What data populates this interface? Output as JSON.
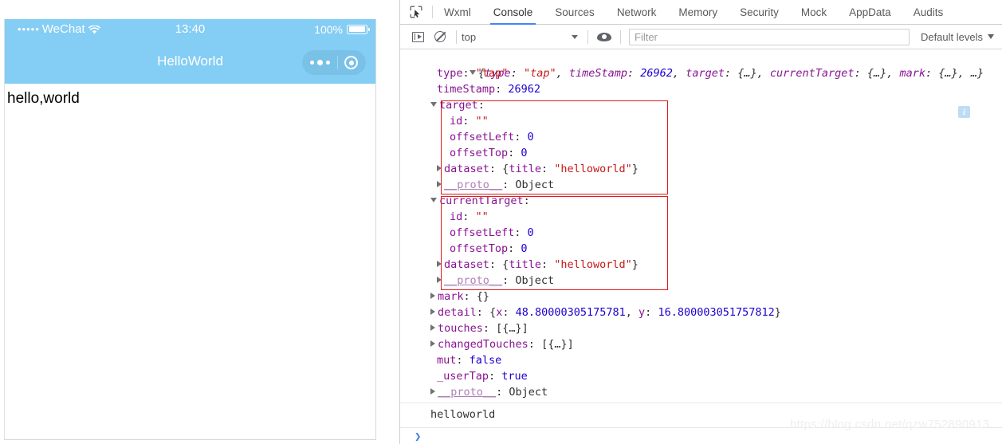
{
  "simulator": {
    "status_bar": {
      "signal_dots": "•••••",
      "carrier": "WeChat",
      "wifi_icon": "wifi-icon",
      "time": "13:40",
      "battery_percent": "100%",
      "battery_icon": "battery-icon"
    },
    "nav": {
      "title": "HelloWorld",
      "capsule": {
        "more_icon": "more-dots-icon",
        "target_icon": "target-circle-icon"
      }
    },
    "page_body_text": "hello,world",
    "theme_color": "#84cdf4",
    "capsule_color": "#7ac1e8"
  },
  "devtools": {
    "inspect_icon": "inspect-cursor-icon",
    "tabs": [
      {
        "label": "Wxml",
        "active": false
      },
      {
        "label": "Console",
        "active": true
      },
      {
        "label": "Sources",
        "active": false
      },
      {
        "label": "Network",
        "active": false
      },
      {
        "label": "Memory",
        "active": false
      },
      {
        "label": "Security",
        "active": false
      },
      {
        "label": "Mock",
        "active": false
      },
      {
        "label": "AppData",
        "active": false
      },
      {
        "label": "Audits",
        "active": false
      }
    ],
    "active_tab_underline_color": "#4285f4",
    "toolbar": {
      "sidebar_toggle_icon": "sidebar-toggle-icon",
      "clear_console_icon": "clear-console-ban-icon",
      "context_selected": "top",
      "context_caret_icon": "chevron-down-icon",
      "eye_icon": "eye-icon",
      "filter_placeholder": "Filter",
      "filter_value": "",
      "levels_label": "Default levels",
      "levels_caret_icon": "chevron-down-icon"
    },
    "console": {
      "summary": {
        "arrow": "▼",
        "open_brace": "{",
        "parts": [
          {
            "key": "type",
            "sep": ": ",
            "value": "\"tap\"",
            "value_class": "v-str"
          },
          {
            "key": "timeStamp",
            "sep": ": ",
            "value": "26962",
            "value_class": "v-num"
          },
          {
            "key": "target",
            "sep": ": ",
            "value": "{…}",
            "value_class": "v-plain"
          },
          {
            "key": "currentTarget",
            "sep": ": ",
            "value": "{…}",
            "value_class": "v-plain"
          },
          {
            "key": "mark",
            "sep": ": ",
            "value": "{…}",
            "value_class": "v-plain"
          }
        ],
        "tail": ", …}",
        "info_badge": "i"
      },
      "lines": [
        {
          "indent": 2,
          "arrow": "",
          "key": "type",
          "value": "\"tap\"",
          "vclass": "v-str"
        },
        {
          "indent": 2,
          "arrow": "",
          "key": "timeStamp",
          "value": "26962",
          "vclass": "v-num"
        },
        {
          "indent": 1,
          "arrow": "▼",
          "key": "target",
          "value": "",
          "vclass": "v-plain"
        },
        {
          "indent": 3,
          "arrow": "",
          "key": "id",
          "value": "\"\"",
          "vclass": "v-str"
        },
        {
          "indent": 3,
          "arrow": "",
          "key": "offsetLeft",
          "value": "0",
          "vclass": "v-num"
        },
        {
          "indent": 3,
          "arrow": "",
          "key": "offsetTop",
          "value": "0",
          "vclass": "v-num"
        },
        {
          "indent": 2,
          "arrow": "▶",
          "key": "dataset",
          "value": "{title: \"helloworld\"}",
          "vclass": "obj-dataset"
        },
        {
          "indent": 2,
          "arrow": "▶",
          "key": "__proto__",
          "value": "Object",
          "vclass": "v-plain",
          "proto": true
        },
        {
          "indent": 1,
          "arrow": "▼",
          "key": "currentTarget",
          "value": "",
          "vclass": "v-plain"
        },
        {
          "indent": 3,
          "arrow": "",
          "key": "id",
          "value": "\"\"",
          "vclass": "v-str"
        },
        {
          "indent": 3,
          "arrow": "",
          "key": "offsetLeft",
          "value": "0",
          "vclass": "v-num"
        },
        {
          "indent": 3,
          "arrow": "",
          "key": "offsetTop",
          "value": "0",
          "vclass": "v-num"
        },
        {
          "indent": 2,
          "arrow": "▶",
          "key": "dataset",
          "value": "{title: \"helloworld\"}",
          "vclass": "obj-dataset"
        },
        {
          "indent": 2,
          "arrow": "▶",
          "key": "__proto__",
          "value": "Object",
          "vclass": "v-plain",
          "proto": true
        },
        {
          "indent": 1,
          "arrow": "▶",
          "key": "mark",
          "value": "{}",
          "vclass": "v-plain"
        },
        {
          "indent": 1,
          "arrow": "▶",
          "key": "detail",
          "value": "{x: 48.80000305175781, y: 16.800003051757812}",
          "vclass": "obj-detail"
        },
        {
          "indent": 1,
          "arrow": "▶",
          "key": "touches",
          "value": "[{…}]",
          "vclass": "v-plain"
        },
        {
          "indent": 1,
          "arrow": "▶",
          "key": "changedTouches",
          "value": "[{…}]",
          "vclass": "v-plain"
        },
        {
          "indent": 2,
          "arrow": "",
          "key": "mut",
          "value": "false",
          "vclass": "v-bool"
        },
        {
          "indent": 2,
          "arrow": "",
          "key": "_userTap",
          "value": "true",
          "vclass": "v-bool"
        },
        {
          "indent": 1,
          "arrow": "▶",
          "key": "__proto__",
          "value": "Object",
          "vclass": "v-plain",
          "proto": true
        }
      ],
      "result_output": "helloworld",
      "prompt_symbol": "❯",
      "annotation_color": "#e21b1b",
      "dataset_detail": {
        "dataset_key": "title",
        "dataset_value": "\"helloworld\"",
        "detail_x_key": "x",
        "detail_x_value": "48.80000305175781",
        "detail_y_key": "y",
        "detail_y_value": "16.800003051757812"
      }
    }
  },
  "watermark": "https://blog.csdn.net/qzw752890913"
}
